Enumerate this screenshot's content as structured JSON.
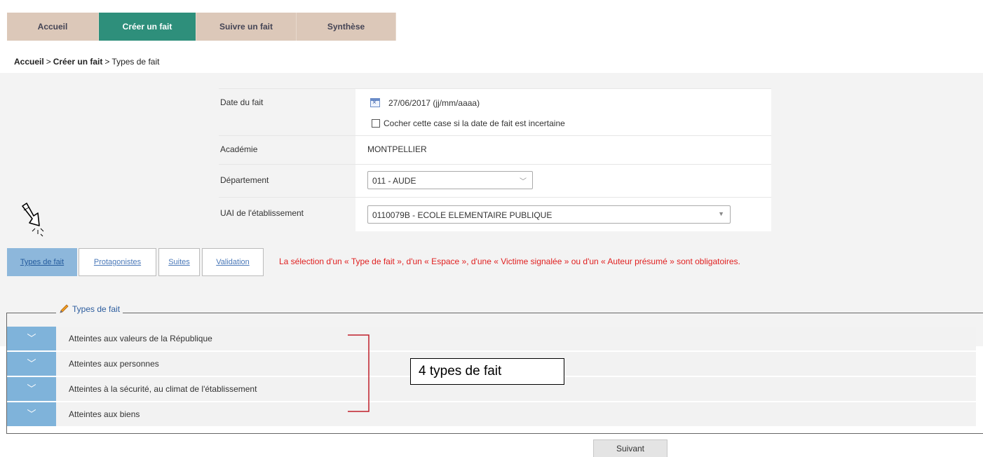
{
  "nav": {
    "tabs": [
      {
        "label": "Accueil"
      },
      {
        "label": "Créer un fait"
      },
      {
        "label": "Suivre un fait"
      },
      {
        "label": "Synthèse"
      }
    ],
    "active_index": 1
  },
  "breadcrumb": {
    "items": [
      "Accueil",
      "Créer un fait"
    ],
    "separator": ">",
    "current": "Types de fait"
  },
  "form": {
    "date": {
      "label": "Date du fait",
      "value": "27/06/2017",
      "format_hint": "(jj/mm/aaaa)",
      "uncertain_checkbox_label": "Cocher cette case si la date de fait est incertaine",
      "uncertain_checked": false
    },
    "academie": {
      "label": "Académie",
      "value": "MONTPELLIER"
    },
    "departement": {
      "label": "Département",
      "value": "011 - AUDE"
    },
    "uai": {
      "label": "UAI de l'établissement",
      "value": "0110079B - ECOLE ELEMENTAIRE PUBLIQUE"
    }
  },
  "subtabs": {
    "items": [
      "Types de fait",
      "Protagonistes",
      "Suites",
      "Validation"
    ],
    "active_index": 0
  },
  "warning": "La sélection d'un « Type de fait », d'un « Espace », d'une « Victime signalée » ou d'un « Auteur présumé » sont obligatoires.",
  "types_de_fait": {
    "legend": "Types de fait",
    "items": [
      "Atteintes aux valeurs de la République",
      "Atteintes aux personnes",
      "Atteintes à la sécurité, au climat de l'établissement",
      "Atteintes aux biens"
    ],
    "expand_icon": "chevron-down-icon"
  },
  "annotation": {
    "callout": "4 types de fait"
  },
  "footer": {
    "next_label": "Suivant"
  },
  "colors": {
    "nav_tab": "#dcc8b9",
    "nav_active": "#2e8f7b",
    "subtab_active": "#8db7db",
    "type_button": "#7fb3da",
    "warning": "#e02020",
    "legend_text": "#2d5d9e"
  }
}
